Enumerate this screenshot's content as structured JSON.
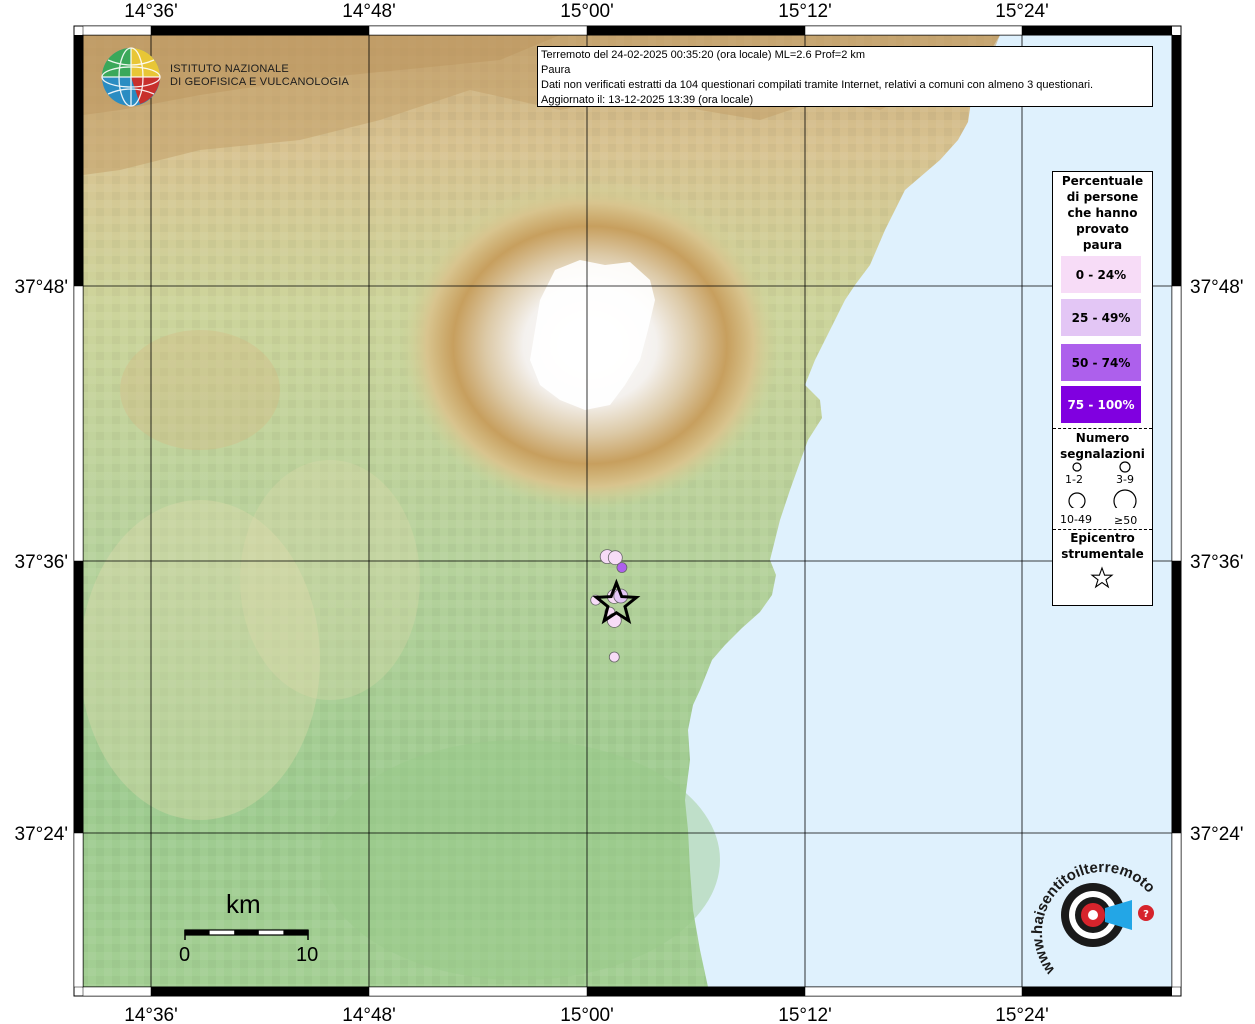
{
  "header": {
    "line1": "Terremoto del 24-02-2025 00:35:20 (ora locale) ML=2.6 Prof=2 km",
    "line2": "Paura",
    "line3": "Dati non verificati estratti da 104 questionari compilati tramite Internet, relativi a comuni con almeno 3 questionari.",
    "line4": "Aggiornato il: 13-12-2025 13:39 (ora locale)"
  },
  "institute": {
    "line1": "ISTITUTO NAZIONALE",
    "line2": "DI GEOFISICA E VULCANOLOGIA"
  },
  "axes": {
    "top_lon": [
      "14°36'",
      "14°48'",
      "15°00'",
      "15°12'",
      "15°24'"
    ],
    "bottom_lon": [
      "14°36'",
      "14°48'",
      "15°00'",
      "15°12'",
      "15°24'"
    ],
    "left_lat": [
      "37°48'",
      "37°36'",
      "37°24'"
    ],
    "right_lat": [
      "37°48'",
      "37°36'",
      "37°24'"
    ]
  },
  "legend": {
    "title_lines": [
      "Percentuale",
      "di persone",
      "che hanno",
      "provato",
      "paura"
    ],
    "classes": [
      {
        "label": "0 - 24%",
        "color": "#f7dcf7",
        "text_color": "#000000"
      },
      {
        "label": "25 - 49%",
        "color": "#e3c6f5",
        "text_color": "#000000"
      },
      {
        "label": "50 - 74%",
        "color": "#ad60ec",
        "text_color": "#000000"
      },
      {
        "label": "75 - 100%",
        "color": "#8000e0",
        "text_color": "#ffffff"
      }
    ],
    "count_title_lines": [
      "Numero",
      "segnalazioni"
    ],
    "sizes": [
      "1-2",
      "3-9",
      "10-49",
      "≥50"
    ],
    "epicenter_lines": [
      "Epicentro",
      "strumentale"
    ]
  },
  "scale": {
    "unit": "km",
    "start": "0",
    "end": "10"
  },
  "reports": [
    {
      "cls": 1,
      "size": 2,
      "lon": 15.0185,
      "lat": 37.6025
    },
    {
      "cls": 1,
      "size": 2,
      "lon": 15.026,
      "lat": 37.6017
    },
    {
      "cls": 3,
      "size": 1,
      "lon": 15.032,
      "lat": 37.5945
    },
    {
      "cls": 1,
      "size": 1,
      "lon": 15.008,
      "lat": 37.5707
    },
    {
      "cls": 1,
      "size": 2,
      "lon": 15.025,
      "lat": 37.5734
    },
    {
      "cls": 2,
      "size": 2,
      "lon": 15.031,
      "lat": 37.5737
    },
    {
      "cls": 1,
      "size": 1,
      "lon": 15.021,
      "lat": 37.562
    },
    {
      "cls": 1,
      "size": 2,
      "lon": 15.025,
      "lat": 37.5559
    },
    {
      "cls": 1,
      "size": 1,
      "lon": 15.025,
      "lat": 37.5292
    }
  ],
  "epicenter": {
    "lon": 15.027,
    "lat": 37.568
  },
  "logo_site": "www.haisentitoilterremoto.it"
}
